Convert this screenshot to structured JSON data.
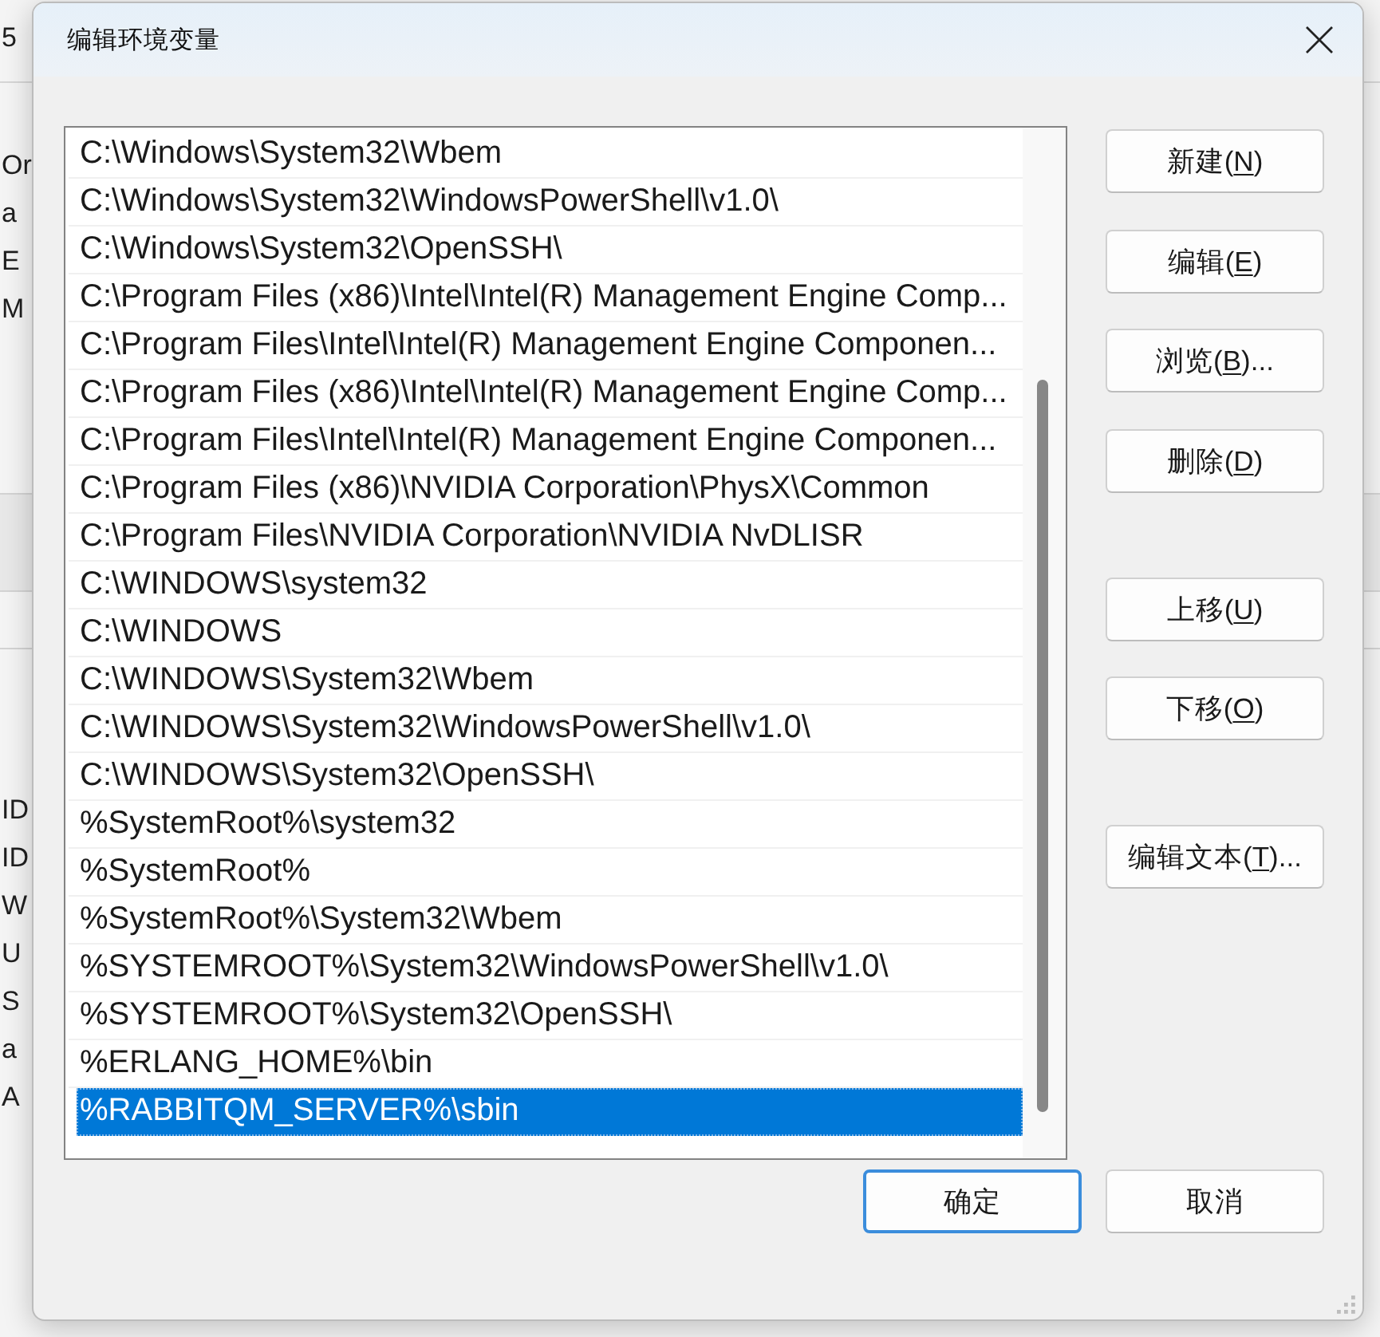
{
  "background_window": {
    "title": "5",
    "rows_top": [
      "Or",
      "a",
      "E",
      "M"
    ],
    "rows_bottom": [
      "ID",
      "ID",
      "W",
      "U",
      "S",
      "a",
      "A"
    ]
  },
  "dialog": {
    "title": "编辑环境变量"
  },
  "path_list": {
    "items": [
      {
        "text": "C:\\Windows\\System32\\Wbem",
        "selected": false
      },
      {
        "text": "C:\\Windows\\System32\\WindowsPowerShell\\v1.0\\",
        "selected": false
      },
      {
        "text": "C:\\Windows\\System32\\OpenSSH\\",
        "selected": false
      },
      {
        "text": "C:\\Program Files (x86)\\Intel\\Intel(R) Management Engine Comp...",
        "selected": false
      },
      {
        "text": "C:\\Program Files\\Intel\\Intel(R) Management Engine Componen...",
        "selected": false
      },
      {
        "text": "C:\\Program Files (x86)\\Intel\\Intel(R) Management Engine Comp...",
        "selected": false
      },
      {
        "text": "C:\\Program Files\\Intel\\Intel(R) Management Engine Componen...",
        "selected": false
      },
      {
        "text": "C:\\Program Files (x86)\\NVIDIA Corporation\\PhysX\\Common",
        "selected": false
      },
      {
        "text": "C:\\Program Files\\NVIDIA Corporation\\NVIDIA NvDLISR",
        "selected": false
      },
      {
        "text": "C:\\WINDOWS\\system32",
        "selected": false
      },
      {
        "text": "C:\\WINDOWS",
        "selected": false
      },
      {
        "text": "C:\\WINDOWS\\System32\\Wbem",
        "selected": false
      },
      {
        "text": "C:\\WINDOWS\\System32\\WindowsPowerShell\\v1.0\\",
        "selected": false
      },
      {
        "text": "C:\\WINDOWS\\System32\\OpenSSH\\",
        "selected": false
      },
      {
        "text": "%SystemRoot%\\system32",
        "selected": false
      },
      {
        "text": "%SystemRoot%",
        "selected": false
      },
      {
        "text": "%SystemRoot%\\System32\\Wbem",
        "selected": false
      },
      {
        "text": "%SYSTEMROOT%\\System32\\WindowsPowerShell\\v1.0\\",
        "selected": false
      },
      {
        "text": "%SYSTEMROOT%\\System32\\OpenSSH\\",
        "selected": false
      },
      {
        "text": "%ERLANG_HOME%\\bin",
        "selected": false
      },
      {
        "text": "%RABBITQM_SERVER%\\sbin",
        "selected": true
      }
    ]
  },
  "side_button_groups": [
    [
      {
        "text_before": "新建(",
        "access_key": "N",
        "text_after": ")"
      },
      {
        "text_before": "编辑(",
        "access_key": "E",
        "text_after": ")"
      },
      {
        "text_before": "浏览(",
        "access_key": "B",
        "text_after": ")..."
      },
      {
        "text_before": "删除(",
        "access_key": "D",
        "text_after": ")"
      }
    ],
    [
      {
        "text_before": "上移(",
        "access_key": "U",
        "text_after": ")"
      },
      {
        "text_before": "下移(",
        "access_key": "O",
        "text_after": ")"
      }
    ],
    [
      {
        "text_before": "编辑文本(",
        "access_key": "T",
        "text_after": ")..."
      }
    ]
  ],
  "dialog_buttons": [
    {
      "label": "确定",
      "default": true
    },
    {
      "label": "取消",
      "default": false
    }
  ]
}
